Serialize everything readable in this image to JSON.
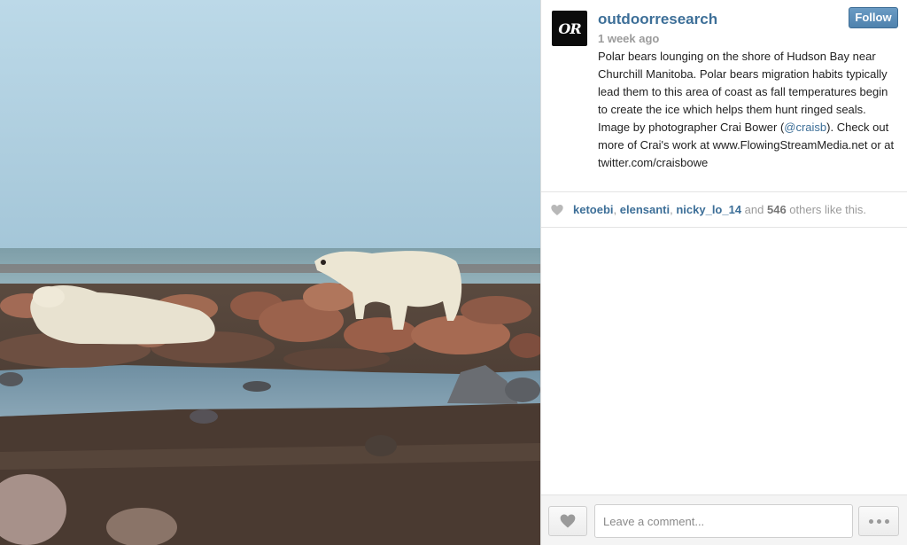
{
  "post": {
    "username": "outdoorresearch",
    "avatar_text": "OR",
    "timestamp": "1 week ago",
    "follow_label": "Follow",
    "caption_part1": "Polar bears lounging on the shore of Hudson Bay near Churchill Manitoba. Polar bears migration habits typically lead them to this area of coast as fall temperatures begin to create the ice which helps them hunt ringed seals. Image by photographer Crai Bower (",
    "caption_mention": "@craisb",
    "caption_part2": "). Check out more of Crai's work at www.FlowingStreamMedia.net or at twitter.com/craisbowe"
  },
  "likes": {
    "users": [
      "ketoebi",
      "elensanti",
      "nicky_lo_14"
    ],
    "sep1": ", ",
    "sep2": ", ",
    "and_text": " and ",
    "count": "546",
    "suffix": " others like this."
  },
  "footer": {
    "comment_placeholder": "Leave a comment..."
  },
  "icons": {
    "heart": "heart-icon",
    "more": "more-dots-icon"
  },
  "colors": {
    "link": "#3d6f98",
    "follow_button": "#5a8cb7"
  }
}
